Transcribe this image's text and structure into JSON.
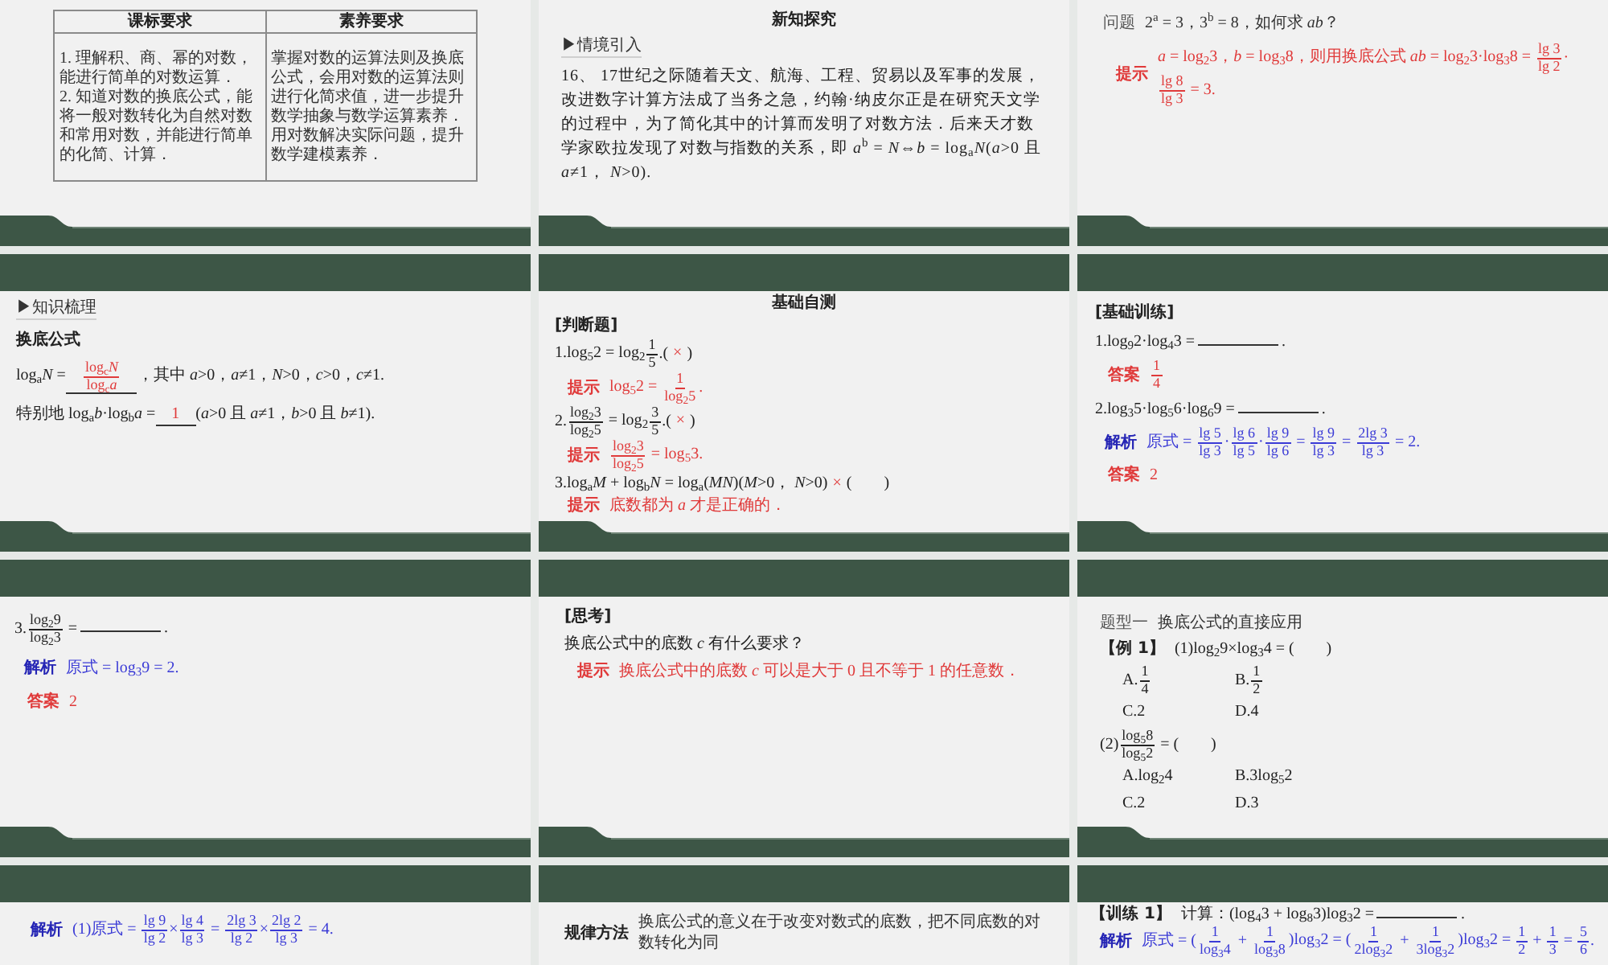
{
  "slides": [
    {
      "blocks": [
        {
          "kind": "table",
          "columns": [
            "课标要求",
            "素养要求"
          ],
          "cells": [
            [
              "1. 理解积、商、幂的对数，能进行简单的对数运算．",
              "2. 知道对数的换底公式，能将一般对数转化为自然对数和常用对数，并能进行简单的化简、计算．"
            ],
            [
              "掌握对数的运算法则及换底公式，会用对数的运算法则进行化简求值，进一步提升数学抽象与数学运算素养．用对数解决实际问题，提升数学建模素养．"
            ]
          ]
        }
      ]
    },
    {
      "blocks": [
        {
          "kind": "title",
          "text": "新知探究"
        },
        {
          "kind": "section",
          "text": "▶情境引入"
        },
        {
          "kind": "paragraph",
          "text": "16、 17世纪之际随着天文、航海、工程、贸易以及军事的发展，改进数字计算方法成了当务之急，约翰·纳皮尔正是在研究天文学的过程中，为了简化其中的计算而发明了对数方法．后来天才数学家欧拉发现了对数与指数的关系，即 *a*$^{b}$ = *N*⇔*b* = log$_{a}$*N*(*a*>0 且 *a*≠1， *N*>0)."
        }
      ]
    },
    {
      "blocks": [
        {
          "kind": "problem",
          "label": "问题",
          "segs": [
            {
              "kind": "text",
              "text": "2$^{a}$ = 3，3$^{b}$ = 8，如何求 *ab*？"
            }
          ]
        },
        {
          "kind": "hint",
          "label": "提示",
          "segs": [
            {
              "kind": "text",
              "text": "*a* = log$_{2}$3，*b* = log$_{3}$8，则用换底公式 *ab* = log$_{2}$3·log$_{3}$8 = "
            },
            {
              "kind": "frac",
              "num": "lg 3",
              "den": "lg 2"
            },
            {
              "kind": "text",
              "text": "·"
            },
            {
              "kind": "frac",
              "num": "lg 8",
              "den": "lg 3"
            },
            {
              "kind": "text",
              "text": " = 3."
            }
          ]
        }
      ]
    },
    {
      "blocks": [
        {
          "kind": "section",
          "text": "▶知识梳理"
        },
        {
          "kind": "heading",
          "text": "换底公式"
        },
        {
          "kind": "statement",
          "segs": [
            {
              "kind": "text",
              "text": "log$_{a}$*N* = "
            },
            {
              "kind": "blank",
              "fill": [
                {
                  "kind": "frac",
                  "num": "log$_{c}$*N*",
                  "den": "log$_{c}$*a*"
                }
              ]
            },
            {
              "kind": "text",
              "text": "，其中 *a*>0，*a*≠1，*N*>0，*c*>0，*c*≠1."
            }
          ]
        },
        {
          "kind": "statement",
          "segs": [
            {
              "kind": "text",
              "text": "特别地 log$_{a}$*b*·log$_{b}$*a* = "
            },
            {
              "kind": "blank",
              "fill": [
                {
                  "kind": "text",
                  "text": "1"
                }
              ]
            },
            {
              "kind": "text",
              "text": " (*a*>0 且 *a*≠1，*b*>0 且 *b*≠1)."
            }
          ]
        }
      ]
    },
    {
      "blocks": [
        {
          "kind": "title",
          "text": "基础自测"
        },
        {
          "kind": "heading",
          "text": "[判断题]"
        },
        {
          "kind": "statement",
          "segs": [
            {
              "kind": "text",
              "text": "1.log$_{5}$2 = log$_{2}$"
            },
            {
              "kind": "frac",
              "num": "1",
              "den": "5"
            },
            {
              "kind": "text",
              "text": ".("
            },
            {
              "kind": "mark",
              "text": "×"
            },
            {
              "kind": "text",
              "text": ")"
            }
          ]
        },
        {
          "kind": "hint",
          "label": "提示",
          "segs": [
            {
              "kind": "text",
              "text": "log$_{5}$2 = "
            },
            {
              "kind": "frac",
              "num": "1",
              "den": "log$_{2}$5"
            },
            {
              "kind": "text",
              "text": "."
            }
          ]
        },
        {
          "kind": "statement",
          "segs": [
            {
              "kind": "text",
              "text": "2."
            },
            {
              "kind": "frac",
              "num": "log$_{2}$3",
              "den": "log$_{2}$5"
            },
            {
              "kind": "text",
              "text": " = log$_{2}$"
            },
            {
              "kind": "frac",
              "num": "3",
              "den": "5"
            },
            {
              "kind": "text",
              "text": ".("
            },
            {
              "kind": "mark",
              "text": "×"
            },
            {
              "kind": "text",
              "text": ")"
            }
          ]
        },
        {
          "kind": "hint",
          "label": "提示",
          "segs": [
            {
              "kind": "frac",
              "num": "log$_{2}$3",
              "den": "log$_{2}$5"
            },
            {
              "kind": "text",
              "text": " = log$_{5}$3."
            }
          ]
        },
        {
          "kind": "statement",
          "segs": [
            {
              "kind": "text",
              "text": "3.log$_{a}$*M* + log$_{b}$*N* = log$_{a}$(*MN*)(*M*>0， *N*>0)"
            },
            {
              "kind": "mark",
              "text": "×"
            },
            {
              "kind": "text",
              "text": "(　　)"
            }
          ]
        },
        {
          "kind": "hint",
          "label": "提示",
          "segs": [
            {
              "kind": "text",
              "text": "底数都为 *a* 才是正确的．"
            }
          ]
        }
      ]
    },
    {
      "blocks": [
        {
          "kind": "heading",
          "text": "[基础训练]"
        },
        {
          "kind": "statement",
          "segs": [
            {
              "kind": "text",
              "text": "1.log$_{9}$2·log$_{4}$3 = "
            },
            {
              "kind": "blank"
            },
            {
              "kind": "text",
              "text": "."
            }
          ]
        },
        {
          "kind": "answer",
          "label": "答案",
          "segs": [
            {
              "kind": "frac",
              "num": "1",
              "den": "4"
            }
          ]
        },
        {
          "kind": "statement",
          "segs": [
            {
              "kind": "text",
              "text": "2.log$_{3}$5·log$_{5}$6·log$_{6}$9 = "
            },
            {
              "kind": "blank"
            },
            {
              "kind": "text",
              "text": "."
            }
          ]
        },
        {
          "kind": "analysis",
          "label": "解析",
          "segs": [
            {
              "kind": "text",
              "text": "原式 = "
            },
            {
              "kind": "frac",
              "num": "lg 5",
              "den": "lg 3"
            },
            {
              "kind": "text",
              "text": "·"
            },
            {
              "kind": "frac",
              "num": "lg 6",
              "den": "lg 5"
            },
            {
              "kind": "text",
              "text": "·"
            },
            {
              "kind": "frac",
              "num": "lg 9",
              "den": "lg 6"
            },
            {
              "kind": "text",
              "text": " = "
            },
            {
              "kind": "frac",
              "num": "lg 9",
              "den": "lg 3"
            },
            {
              "kind": "text",
              "text": " = "
            },
            {
              "kind": "frac",
              "num": "2lg 3",
              "den": "lg 3"
            },
            {
              "kind": "text",
              "text": " = 2."
            }
          ]
        },
        {
          "kind": "answer",
          "label": "答案",
          "segs": [
            {
              "kind": "text",
              "text": "2"
            }
          ]
        }
      ]
    },
    {
      "blocks": [
        {
          "kind": "statement",
          "segs": [
            {
              "kind": "text",
              "text": "3."
            },
            {
              "kind": "frac",
              "num": "log$_{2}$9",
              "den": "log$_{2}$3"
            },
            {
              "kind": "text",
              "text": " = "
            },
            {
              "kind": "blank"
            },
            {
              "kind": "text",
              "text": "."
            }
          ]
        },
        {
          "kind": "analysis",
          "label": "解析",
          "segs": [
            {
              "kind": "text",
              "text": "原式 = log$_{3}$9 = 2."
            }
          ]
        },
        {
          "kind": "answer",
          "label": "答案",
          "segs": [
            {
              "kind": "text",
              "text": "2"
            }
          ]
        }
      ]
    },
    {
      "blocks": [
        {
          "kind": "heading",
          "text": "[思考]"
        },
        {
          "kind": "statement",
          "segs": [
            {
              "kind": "text",
              "text": "换底公式中的底数 *c* 有什么要求？"
            }
          ]
        },
        {
          "kind": "hint",
          "label": "提示",
          "segs": [
            {
              "kind": "text",
              "text": "换底公式中的底数 *c* 可以是大于 0 且不等于 1 的任意数．"
            }
          ]
        }
      ]
    },
    {
      "blocks": [
        {
          "kind": "problem",
          "label": "题型一",
          "segs": [
            {
              "kind": "text",
              "text": "换底公式的直接应用"
            }
          ]
        },
        {
          "kind": "example",
          "label": "【例 1】",
          "segs": [
            {
              "kind": "text",
              "text": "(1)log$_{2}$9×log$_{3}$4 = (　　)"
            }
          ]
        },
        {
          "kind": "options",
          "items": [
            {
              "segs": [
                {
                  "kind": "text",
                  "text": "A."
                },
                {
                  "kind": "frac",
                  "num": "1",
                  "den": "4"
                }
              ]
            },
            {
              "segs": [
                {
                  "kind": "text",
                  "text": "B."
                },
                {
                  "kind": "frac",
                  "num": "1",
                  "den": "2"
                }
              ]
            },
            {
              "segs": [
                {
                  "kind": "text",
                  "text": "C.2"
                }
              ]
            },
            {
              "segs": [
                {
                  "kind": "text",
                  "text": "D.4"
                }
              ]
            }
          ]
        },
        {
          "kind": "statement",
          "segs": [
            {
              "kind": "text",
              "text": "(2)"
            },
            {
              "kind": "frac",
              "num": "log$_{5}$8",
              "den": "log$_{5}$2"
            },
            {
              "kind": "text",
              "text": " = (　　)"
            }
          ]
        },
        {
          "kind": "options",
          "items": [
            {
              "segs": [
                {
                  "kind": "text",
                  "text": "A.log$_{2}$4"
                }
              ]
            },
            {
              "segs": [
                {
                  "kind": "text",
                  "text": "B.3log$_{5}$2"
                }
              ]
            },
            {
              "segs": [
                {
                  "kind": "text",
                  "text": "C.2"
                }
              ]
            },
            {
              "segs": [
                {
                  "kind": "text",
                  "text": "D.3"
                }
              ]
            }
          ]
        }
      ]
    },
    {
      "blocks": [
        {
          "kind": "analysis",
          "label": "解析",
          "segs": [
            {
              "kind": "text",
              "text": "(1)原式 = "
            },
            {
              "kind": "frac",
              "num": "lg 9",
              "den": "lg 2"
            },
            {
              "kind": "text",
              "text": "×"
            },
            {
              "kind": "frac",
              "num": "lg 4",
              "den": "lg 3"
            },
            {
              "kind": "text",
              "text": " = "
            },
            {
              "kind": "frac",
              "num": "2lg 3",
              "den": "lg 2"
            },
            {
              "kind": "text",
              "text": "×"
            },
            {
              "kind": "frac",
              "num": "2lg 2",
              "den": "lg 3"
            },
            {
              "kind": "text",
              "text": " = 4."
            }
          ]
        }
      ]
    },
    {
      "blocks": [
        {
          "kind": "method",
          "label": "规律方法",
          "segs": [
            {
              "kind": "text",
              "text": "换底公式的意义在于改变对数式的底数，把不同底数的对数转化为同"
            }
          ]
        }
      ]
    },
    {
      "blocks": [
        {
          "kind": "example",
          "label": "【训练 1】",
          "segs": [
            {
              "kind": "text",
              "text": "计算：(log$_{4}$3 + log$_{8}$3)log$_{3}$2 = "
            },
            {
              "kind": "blank"
            },
            {
              "kind": "text",
              "text": "."
            }
          ]
        },
        {
          "kind": "analysis",
          "label": "解析",
          "segs": [
            {
              "kind": "text",
              "text": "原式 = ("
            },
            {
              "kind": "frac",
              "num": "1",
              "den": "log$_{3}$4"
            },
            {
              "kind": "text",
              "text": " + "
            },
            {
              "kind": "frac",
              "num": "1",
              "den": "log$_{3}$8"
            },
            {
              "kind": "text",
              "text": ")log$_{3}$2 = ("
            },
            {
              "kind": "frac",
              "num": "1",
              "den": "2log$_{3}$2"
            },
            {
              "kind": "text",
              "text": " + "
            },
            {
              "kind": "frac",
              "num": "1",
              "den": "3log$_{3}$2"
            },
            {
              "kind": "text",
              "text": ")log$_{3}$2 = "
            },
            {
              "kind": "frac",
              "num": "1",
              "den": "2"
            },
            {
              "kind": "text",
              "text": " + "
            },
            {
              "kind": "frac",
              "num": "1",
              "den": "3"
            },
            {
              "kind": "text",
              "text": " = "
            },
            {
              "kind": "frac",
              "num": "5",
              "den": "6"
            },
            {
              "kind": "text",
              "text": "."
            }
          ]
        }
      ]
    }
  ]
}
